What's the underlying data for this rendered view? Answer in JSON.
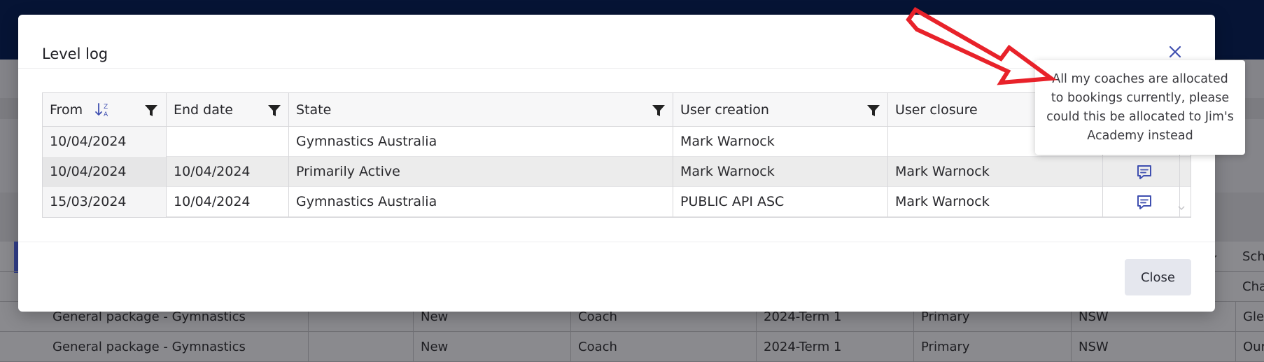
{
  "background": {
    "rows": [
      {
        "package": "General package - Gymnastics",
        "status": "New",
        "role": "Coach",
        "term": "2024-Term 1",
        "level": "Primary",
        "state": "NSW",
        "school": "Glen"
      },
      {
        "package": "General package - Gymnastics",
        "status": "New",
        "role": "Coach",
        "term": "2024-Term 1",
        "level": "Primary",
        "state": "NSW",
        "school": "Our I"
      }
    ],
    "partial_header": "Scho",
    "partial_cell": "Chalo"
  },
  "modal": {
    "title": "Level log",
    "close_label": "Close",
    "table": {
      "columns": {
        "from": "From",
        "end_date": "End date",
        "state": "State",
        "user_creation": "User creation",
        "user_closure": "User closure"
      },
      "rows": [
        {
          "from": "10/04/2024",
          "end_date": "",
          "state": "Gymnastics Australia",
          "user_creation": "Mark Warnock",
          "user_closure": ""
        },
        {
          "from": "10/04/2024",
          "end_date": "10/04/2024",
          "state": "Primarily Active",
          "user_creation": "Mark Warnock",
          "user_closure": "Mark Warnock"
        },
        {
          "from": "15/03/2024",
          "end_date": "10/04/2024",
          "state": "Gymnastics Australia",
          "user_creation": "PUBLIC API ASC",
          "user_closure": "Mark Warnock"
        }
      ]
    }
  },
  "tooltip": {
    "text": "All my coaches are allocated to bookings currently, please could this be allocated to Jim's Academy instead"
  },
  "colors": {
    "accent": "#3f4fb0",
    "annotation_arrow": "#e8222a",
    "header_bg": "#061435"
  },
  "icons": [
    "close-icon",
    "sort-z-a-icon",
    "filter-icon",
    "comment-icon",
    "chevron-down-icon"
  ]
}
